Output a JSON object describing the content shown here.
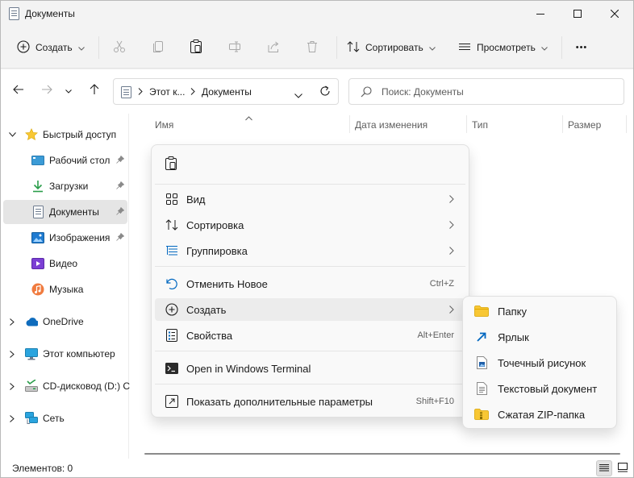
{
  "window": {
    "title": "Документы"
  },
  "toolbar": {
    "create_label": "Создать",
    "sort_label": "Сортировать",
    "view_label": "Просмотреть",
    "more_label": "•••"
  },
  "address": {
    "segments": [
      "Этот к...",
      "Документы"
    ]
  },
  "search": {
    "placeholder": "Поиск: Документы"
  },
  "sidebar": {
    "items": [
      {
        "label": "Быстрый доступ",
        "icon": "star-icon"
      },
      {
        "label": "Рабочий стол",
        "icon": "desktop-icon",
        "pinned": true
      },
      {
        "label": "Загрузки",
        "icon": "download-icon",
        "pinned": true
      },
      {
        "label": "Документы",
        "icon": "documents-icon",
        "pinned": true,
        "selected": true
      },
      {
        "label": "Изображения",
        "icon": "pictures-icon",
        "pinned": true
      },
      {
        "label": "Видео",
        "icon": "video-icon"
      },
      {
        "label": "Музыка",
        "icon": "music-icon"
      },
      {
        "label": "OneDrive",
        "icon": "cloud-icon"
      },
      {
        "label": "Этот компьютер",
        "icon": "computer-icon"
      },
      {
        "label": "CD-дисковод (D:) C",
        "icon": "cd-drive-icon"
      },
      {
        "label": "Сеть",
        "icon": "network-icon"
      }
    ]
  },
  "columns": [
    "Имя",
    "Дата изменения",
    "Тип",
    "Размер"
  ],
  "context_menu": {
    "items": [
      {
        "label": "Вид",
        "icon": "grid-icon",
        "has_submenu": true
      },
      {
        "label": "Сортировка",
        "icon": "sort-icon",
        "has_submenu": true
      },
      {
        "label": "Группировка",
        "icon": "group-icon",
        "has_submenu": true
      },
      {
        "label": "Отменить Новое",
        "icon": "undo-icon",
        "shortcut": "Ctrl+Z"
      },
      {
        "label": "Создать",
        "icon": "add-circle-icon",
        "has_submenu": true,
        "highlighted": true
      },
      {
        "label": "Свойства",
        "icon": "properties-icon",
        "shortcut": "Alt+Enter"
      },
      {
        "label": "Open in Windows Terminal",
        "icon": "terminal-icon"
      },
      {
        "label": "Показать дополнительные параметры",
        "icon": "show-more-icon",
        "shortcut": "Shift+F10"
      }
    ]
  },
  "submenu": {
    "items": [
      {
        "label": "Папку",
        "icon": "folder-icon"
      },
      {
        "label": "Ярлык",
        "icon": "shortcut-icon"
      },
      {
        "label": "Точечный рисунок",
        "icon": "bitmap-icon"
      },
      {
        "label": "Текстовый документ",
        "icon": "text-document-icon"
      },
      {
        "label": "Сжатая ZIP-папка",
        "icon": "zip-folder-icon"
      }
    ]
  },
  "status": {
    "items_text": "Элементов: 0"
  },
  "colors": {
    "accent": "#0067c0",
    "folder": "#f8c734",
    "selection": "#e5e5e5"
  }
}
